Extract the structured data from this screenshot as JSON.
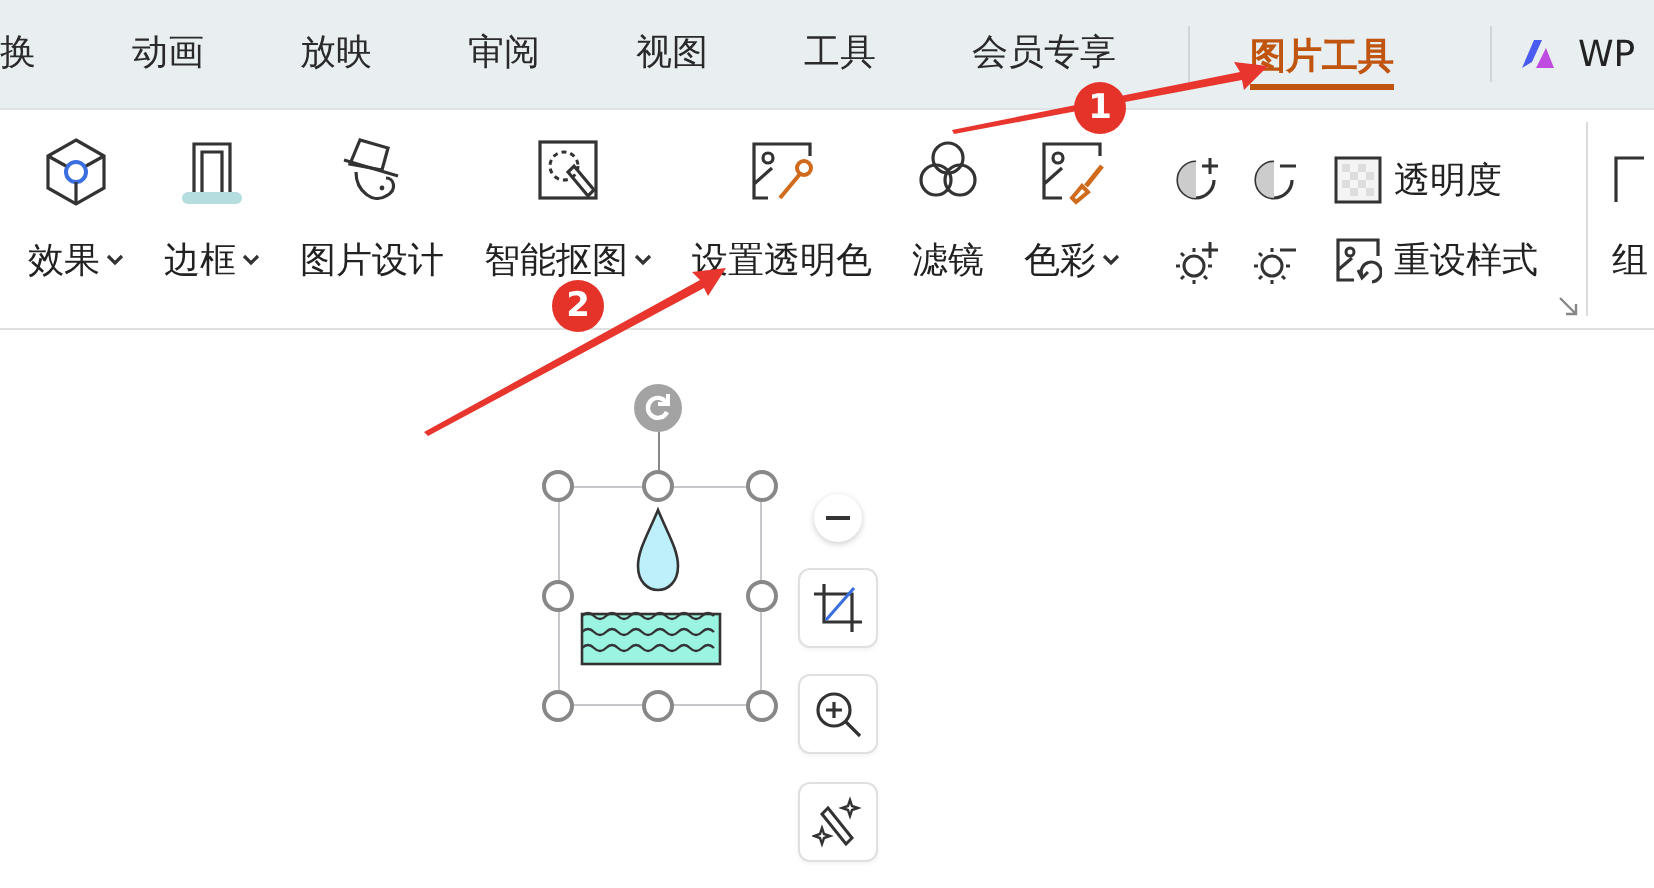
{
  "tabs": [
    {
      "label": "换",
      "selected": false
    },
    {
      "label": "动画",
      "selected": false
    },
    {
      "label": "放映",
      "selected": false
    },
    {
      "label": "审阅",
      "selected": false
    },
    {
      "label": "视图",
      "selected": false
    },
    {
      "label": "工具",
      "selected": false
    },
    {
      "label": "会员专享",
      "selected": false
    },
    {
      "label": "图片工具",
      "selected": true
    }
  ],
  "ai_tab": {
    "label": "WP"
  },
  "ribbon": {
    "large_buttons": [
      {
        "label": "效果",
        "dropdown": true
      },
      {
        "label": "边框",
        "dropdown": true
      },
      {
        "label": "图片设计",
        "dropdown": false
      },
      {
        "label": "智能抠图",
        "dropdown": true
      },
      {
        "label": "设置透明色",
        "dropdown": false
      },
      {
        "label": "滤镜",
        "dropdown": false
      },
      {
        "label": "色彩",
        "dropdown": true
      }
    ],
    "text_buttons": [
      {
        "label": "透明度"
      },
      {
        "label": "重设样式"
      }
    ],
    "cut_label": "组"
  },
  "annotations": [
    {
      "number": "1"
    },
    {
      "number": "2"
    }
  ]
}
